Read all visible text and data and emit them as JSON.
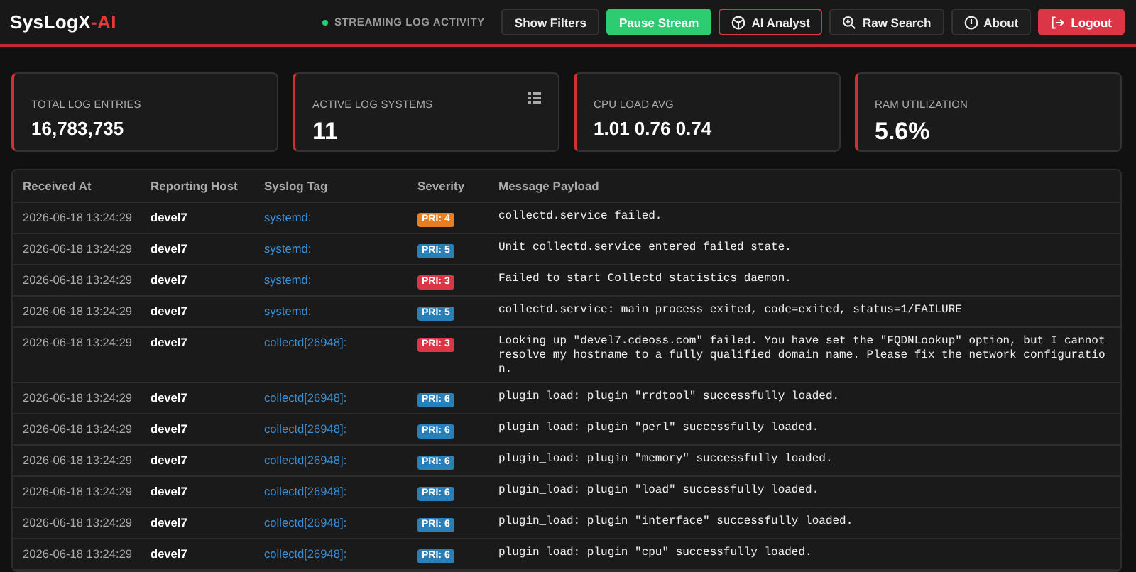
{
  "header": {
    "brand": "SysLogX",
    "brand_suffix": "-AI",
    "status": {
      "label": "STREAMING LOG ACTIVITY",
      "live": true
    },
    "buttons": [
      {
        "label": "Show Filters",
        "kind": "filters"
      },
      {
        "label": "Pause Stream",
        "kind": "pause"
      },
      {
        "label": "AI Analyst",
        "kind": "ai"
      },
      {
        "label": "Raw Search",
        "kind": "search"
      },
      {
        "label": "About",
        "kind": "about"
      },
      {
        "label": "Logout",
        "kind": "logout"
      }
    ]
  },
  "stats": [
    {
      "label": "TOTAL LOG ENTRIES",
      "value": "16,783,735"
    },
    {
      "label": "ACTIVE LOG SYSTEMS",
      "value": "11"
    },
    {
      "label": "CPU LOAD AVG",
      "value": "1.01 0.76 0.74"
    },
    {
      "label": "RAM UTILIZATION",
      "value": "5.6%"
    }
  ],
  "table": {
    "columns": [
      "Received At",
      "Reporting Host",
      "Syslog Tag",
      "Severity",
      "Message Payload"
    ],
    "rows": [
      {
        "received_at": "2026-06-18 13:24:29",
        "host": "devel7",
        "tag": "systemd:",
        "severity": "PRI: 4",
        "color": "#e67e22",
        "message": "collectd.service failed."
      },
      {
        "received_at": "2026-06-18 13:24:29",
        "host": "devel7",
        "tag": "systemd:",
        "severity": "PRI: 5",
        "color": "#2980b9",
        "message": "Unit collectd.service entered failed state."
      },
      {
        "received_at": "2026-06-18 13:24:29",
        "host": "devel7",
        "tag": "systemd:",
        "severity": "PRI: 3",
        "color": "#dc3545",
        "message": "Failed to start Collectd statistics daemon."
      },
      {
        "received_at": "2026-06-18 13:24:29",
        "host": "devel7",
        "tag": "systemd:",
        "severity": "PRI: 5",
        "color": "#2980b9",
        "message": "collectd.service: main process exited, code=exited, status=1/FAILURE"
      },
      {
        "received_at": "2026-06-18 13:24:29",
        "host": "devel7",
        "tag": "collectd[26948]:",
        "severity": "PRI: 3",
        "color": "#dc3545",
        "message": "Looking up \"devel7.cdeoss.com\" failed. You have set the \"FQDNLookup\" option, but I cannot resolve my hostname to a fully qualified domain name. Please fix the network configuration."
      },
      {
        "received_at": "2026-06-18 13:24:29",
        "host": "devel7",
        "tag": "collectd[26948]:",
        "severity": "PRI: 6",
        "color": "#2980b9",
        "message": "plugin_load: plugin \"rrdtool\" successfully loaded."
      },
      {
        "received_at": "2026-06-18 13:24:29",
        "host": "devel7",
        "tag": "collectd[26948]:",
        "severity": "PRI: 6",
        "color": "#2980b9",
        "message": "plugin_load: plugin \"perl\" successfully loaded."
      },
      {
        "received_at": "2026-06-18 13:24:29",
        "host": "devel7",
        "tag": "collectd[26948]:",
        "severity": "PRI: 6",
        "color": "#2980b9",
        "message": "plugin_load: plugin \"memory\" successfully loaded."
      },
      {
        "received_at": "2026-06-18 13:24:29",
        "host": "devel7",
        "tag": "collectd[26948]:",
        "severity": "PRI: 6",
        "color": "#2980b9",
        "message": "plugin_load: plugin \"load\" successfully loaded."
      },
      {
        "received_at": "2026-06-18 13:24:29",
        "host": "devel7",
        "tag": "collectd[26948]:",
        "severity": "PRI: 6",
        "color": "#2980b9",
        "message": "plugin_load: plugin \"interface\" successfully loaded."
      },
      {
        "received_at": "2026-06-18 13:24:29",
        "host": "devel7",
        "tag": "collectd[26948]:",
        "severity": "PRI: 6",
        "color": "#2980b9",
        "message": "plugin_load: plugin \"cpu\" successfully loaded."
      }
    ]
  }
}
